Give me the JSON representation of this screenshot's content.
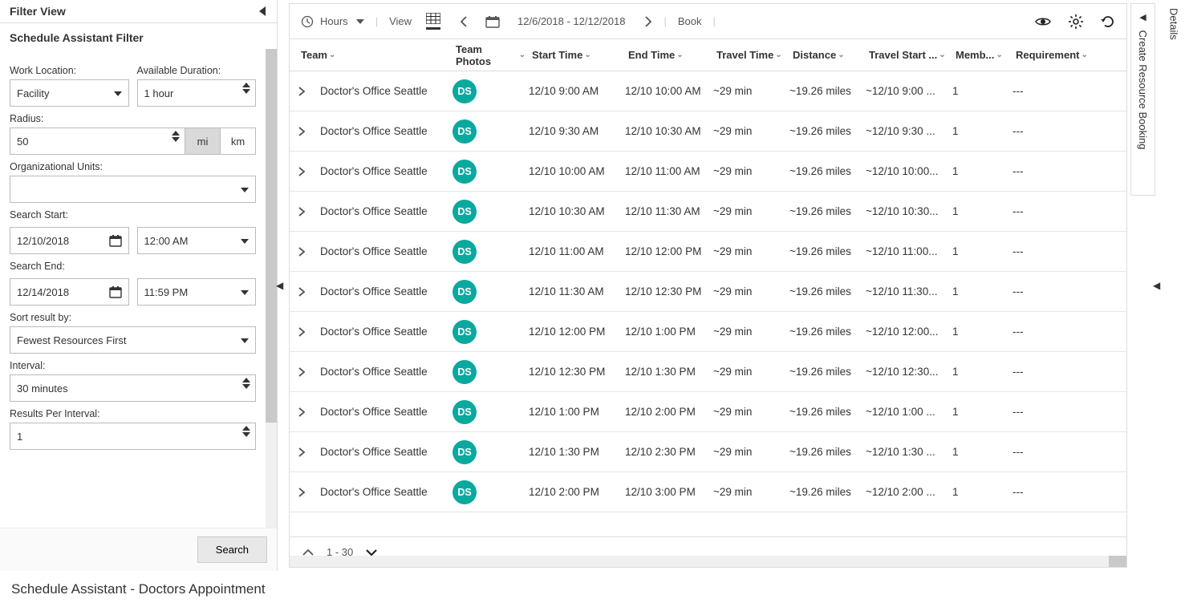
{
  "filterView": {
    "title": "Filter View"
  },
  "filterSubtitle": "Schedule Assistant Filter",
  "filters": {
    "workLocation": {
      "label": "Work Location:",
      "value": "Facility"
    },
    "availableDuration": {
      "label": "Available Duration:",
      "value": "1 hour"
    },
    "radius": {
      "label": "Radius:",
      "value": "50",
      "unit_mi": "mi",
      "unit_km": "km"
    },
    "orgUnits": {
      "label": "Organizational Units:",
      "value": ""
    },
    "searchStart": {
      "label": "Search Start:",
      "date": "12/10/2018",
      "time": "12:00 AM"
    },
    "searchEnd": {
      "label": "Search End:",
      "date": "12/14/2018",
      "time": "11:59 PM"
    },
    "sortBy": {
      "label": "Sort result by:",
      "value": "Fewest Resources First"
    },
    "interval": {
      "label": "Interval:",
      "value": "30 minutes"
    },
    "resultsPerInterval": {
      "label": "Results Per Interval:",
      "value": "1"
    }
  },
  "searchBtn": "Search",
  "toolbar": {
    "hours": "Hours",
    "view": "View",
    "dateRange": "12/6/2018 - 12/12/2018",
    "book": "Book"
  },
  "columns": {
    "team": "Team",
    "photos": "Team Photos",
    "start": "Start Time",
    "end": "End Time",
    "travel": "Travel Time",
    "distance": "Distance",
    "travelStart": "Travel Start ...",
    "members": "Memb...",
    "requirement": "Requirement"
  },
  "avatar": "DS",
  "rows": [
    {
      "team": "Doctor's Office Seattle",
      "start": "12/10 9:00 AM",
      "end": "12/10 10:00 AM",
      "travel": "~29 min",
      "distance": "~19.26 miles",
      "ts": "~12/10 9:00 ...",
      "members": "1",
      "req": "---"
    },
    {
      "team": "Doctor's Office Seattle",
      "start": "12/10 9:30 AM",
      "end": "12/10 10:30 AM",
      "travel": "~29 min",
      "distance": "~19.26 miles",
      "ts": "~12/10 9:30 ...",
      "members": "1",
      "req": "---"
    },
    {
      "team": "Doctor's Office Seattle",
      "start": "12/10 10:00 AM",
      "end": "12/10 11:00 AM",
      "travel": "~29 min",
      "distance": "~19.26 miles",
      "ts": "~12/10 10:00...",
      "members": "1",
      "req": "---"
    },
    {
      "team": "Doctor's Office Seattle",
      "start": "12/10 10:30 AM",
      "end": "12/10 11:30 AM",
      "travel": "~29 min",
      "distance": "~19.26 miles",
      "ts": "~12/10 10:30...",
      "members": "1",
      "req": "---"
    },
    {
      "team": "Doctor's Office Seattle",
      "start": "12/10 11:00 AM",
      "end": "12/10 12:00 PM",
      "travel": "~29 min",
      "distance": "~19.26 miles",
      "ts": "~12/10 11:00...",
      "members": "1",
      "req": "---"
    },
    {
      "team": "Doctor's Office Seattle",
      "start": "12/10 11:30 AM",
      "end": "12/10 12:30 PM",
      "travel": "~29 min",
      "distance": "~19.26 miles",
      "ts": "~12/10 11:30...",
      "members": "1",
      "req": "---"
    },
    {
      "team": "Doctor's Office Seattle",
      "start": "12/10 12:00 PM",
      "end": "12/10 1:00 PM",
      "travel": "~29 min",
      "distance": "~19.26 miles",
      "ts": "~12/10 12:00...",
      "members": "1",
      "req": "---"
    },
    {
      "team": "Doctor's Office Seattle",
      "start": "12/10 12:30 PM",
      "end": "12/10 1:30 PM",
      "travel": "~29 min",
      "distance": "~19.26 miles",
      "ts": "~12/10 12:30...",
      "members": "1",
      "req": "---"
    },
    {
      "team": "Doctor's Office Seattle",
      "start": "12/10 1:00 PM",
      "end": "12/10 2:00 PM",
      "travel": "~29 min",
      "distance": "~19.26 miles",
      "ts": "~12/10 1:00 ...",
      "members": "1",
      "req": "---"
    },
    {
      "team": "Doctor's Office Seattle",
      "start": "12/10 1:30 PM",
      "end": "12/10 2:30 PM",
      "travel": "~29 min",
      "distance": "~19.26 miles",
      "ts": "~12/10 1:30 ...",
      "members": "1",
      "req": "---"
    },
    {
      "team": "Doctor's Office Seattle",
      "start": "12/10 2:00 PM",
      "end": "12/10 3:00 PM",
      "travel": "~29 min",
      "distance": "~19.26 miles",
      "ts": "~12/10 2:00 ...",
      "members": "1",
      "req": "---"
    }
  ],
  "pager": {
    "range": "1 - 30"
  },
  "sidePanels": {
    "create": "Create Resource Booking",
    "details": "Details"
  },
  "bottomTitle": "Schedule Assistant - Doctors Appointment"
}
